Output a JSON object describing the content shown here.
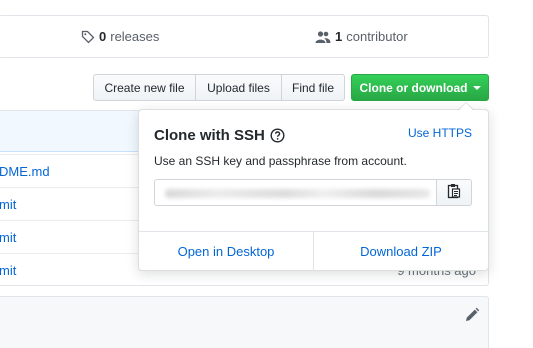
{
  "stats": {
    "releases_count": "0",
    "releases_label": "releases",
    "contributors_count": "1",
    "contributors_label": "contributor"
  },
  "toolbar": {
    "create_label": "Create new file",
    "upload_label": "Upload files",
    "find_label": "Find file",
    "clone_label": "Clone or download"
  },
  "files": [
    {
      "name": "DME.md",
      "age": ""
    },
    {
      "name": "mit",
      "age": ""
    },
    {
      "name": "mit",
      "age": ""
    },
    {
      "name": "mit",
      "age": "9 months ago"
    }
  ],
  "clone_panel": {
    "title": "Clone with SSH",
    "switch_link": "Use HTTPS",
    "description": "Use an SSH key and passphrase from account.",
    "open_desktop": "Open in Desktop",
    "download_zip": "Download ZIP"
  },
  "colors": {
    "accent": "#0366d6",
    "clone_green": "#28a745"
  },
  "icons": [
    "tag-icon",
    "people-icon",
    "caret-down-icon",
    "question-icon",
    "clipboard-icon",
    "pencil-icon"
  ]
}
